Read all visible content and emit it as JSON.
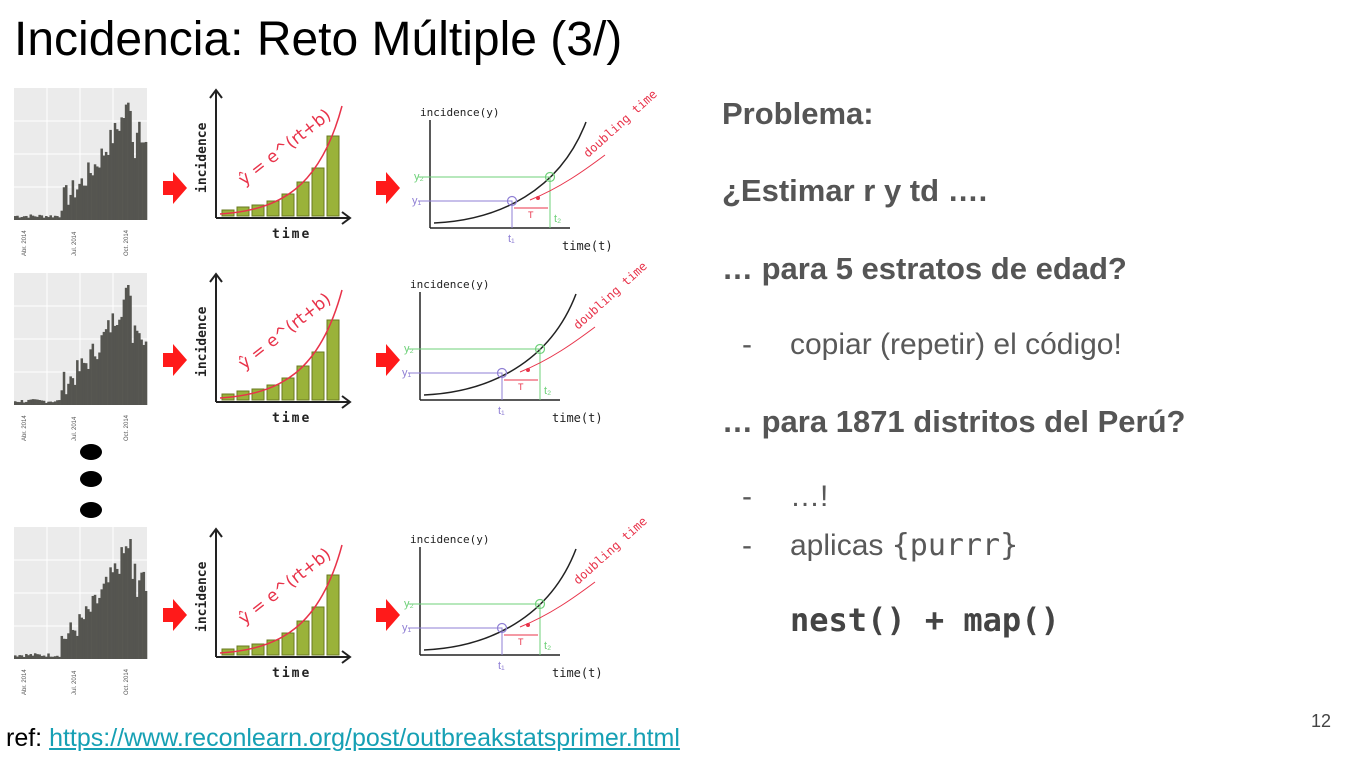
{
  "slide": {
    "title": "Incidencia: Reto Múltiple (3/)",
    "page_number": "12"
  },
  "right_text": {
    "heading": "Problema:",
    "question": "¿Estimar r y td ….",
    "age_strata": "… para 5 estratos de edad?",
    "dash": "-",
    "copy_code": "copiar (repetir) el código!",
    "districts": "… para 1871 distritos del Perú?",
    "ellipsis_item": "…!",
    "apply_prefix": "aplicas ",
    "apply_pkg": "{purrr}",
    "code": "nest() + map()"
  },
  "reference": {
    "label": "ref: ",
    "url": "https://www.reconlearn.org/post/outbreakstatsprimer.html"
  },
  "figure": {
    "hist_dates": [
      "Abr. 2014",
      "Jul. 2014",
      "Oct. 2014"
    ],
    "exp_ylabel": "incidence",
    "exp_xlabel": "time",
    "exp_formula": "ŷ = e^(rt+b)",
    "dbl_ylabel": "incidence(y)",
    "dbl_xlabel": "time(t)",
    "dbl_annotation": "doubling time",
    "y1": "y₁",
    "y2": "y₂",
    "t1": "t₁",
    "t2": "t₂",
    "T": "T",
    "colors": {
      "arrow": "#ff1a1a",
      "curve": "#e8334a",
      "green": "#6fd17a",
      "purple": "#8f7fd4",
      "bars": "#9ab23a",
      "hist": "#555550",
      "panel": "#ebebeb"
    }
  }
}
